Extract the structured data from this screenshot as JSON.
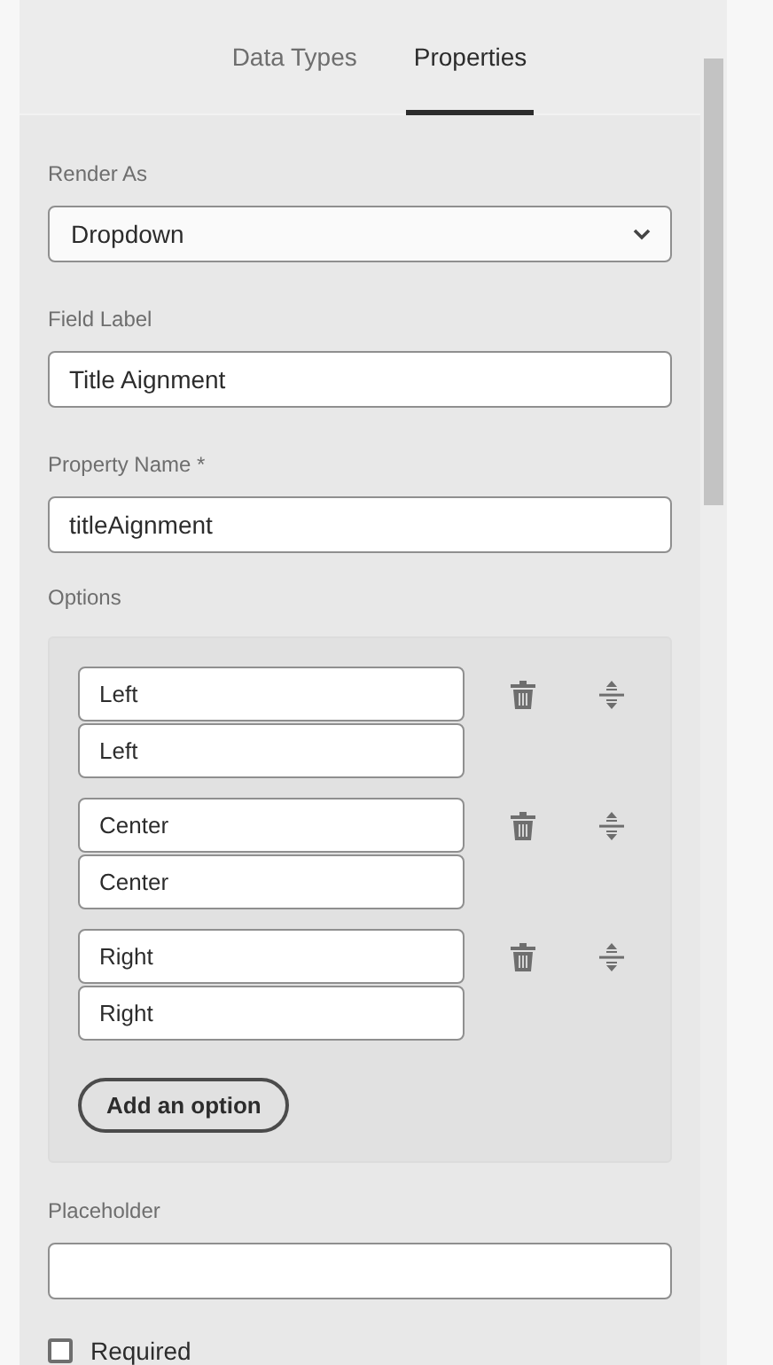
{
  "tabs": [
    {
      "label": "Data Types",
      "selected": false
    },
    {
      "label": "Properties",
      "selected": true
    }
  ],
  "render_as": {
    "label": "Render As",
    "value": "Dropdown"
  },
  "field_label": {
    "label": "Field Label",
    "value": "Title Aignment"
  },
  "property_name": {
    "label": "Property Name *",
    "value": "titleAignment"
  },
  "options": {
    "label": "Options",
    "items": [
      {
        "label": "Left",
        "value": "Left"
      },
      {
        "label": "Center",
        "value": "Center"
      },
      {
        "label": "Right",
        "value": "Right"
      }
    ],
    "add_button": "Add an option"
  },
  "placeholder": {
    "label": "Placeholder"
  },
  "required": {
    "label": "Required",
    "checked": false
  }
}
